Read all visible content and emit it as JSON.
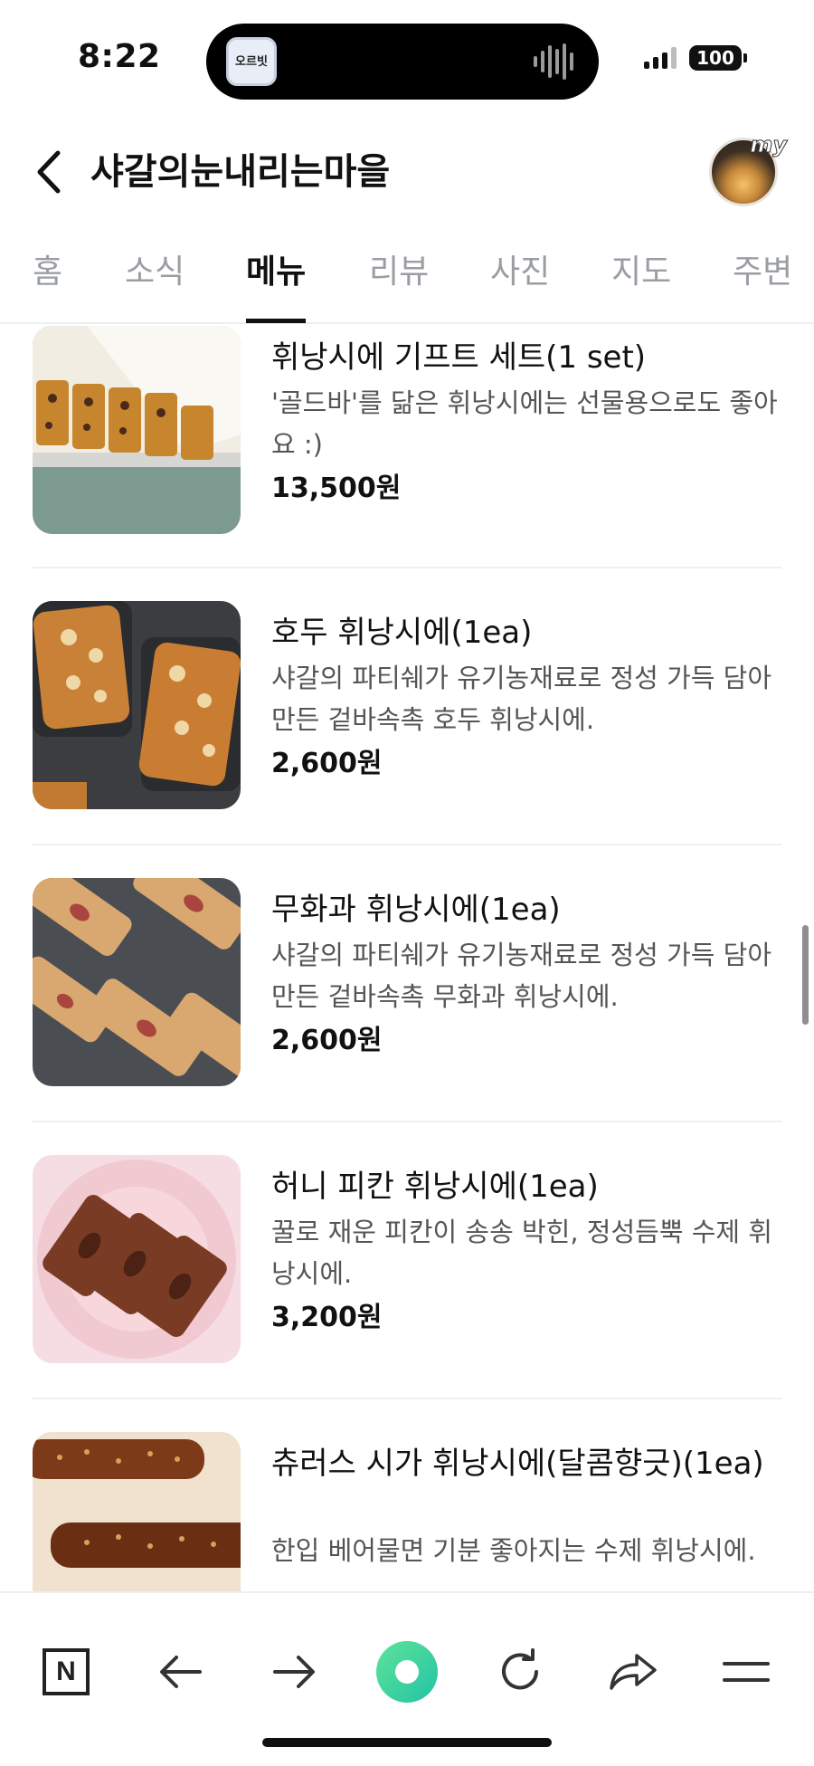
{
  "status_bar": {
    "time": "8:22",
    "island_app_label": "오르빗",
    "battery": "100",
    "icons": [
      "signal-icon",
      "battery-icon",
      "waveform-icon"
    ]
  },
  "header": {
    "title": "샤갈의눈내리는마을",
    "my_badge": "my",
    "icons": [
      "back-arrow-icon",
      "profile-avatar"
    ]
  },
  "tabs": [
    {
      "label": "홈",
      "active": false
    },
    {
      "label": "소식",
      "active": false
    },
    {
      "label": "메뉴",
      "active": true
    },
    {
      "label": "리뷰",
      "active": false
    },
    {
      "label": "사진",
      "active": false
    },
    {
      "label": "지도",
      "active": false
    },
    {
      "label": "주변",
      "active": false
    }
  ],
  "menu_items": [
    {
      "name": "휘낭시에 기프트 세트(1 set)",
      "description": "'골드바'를 닮은 휘낭시에는 선물용으로도 좋아요 :)",
      "price": "13,500원"
    },
    {
      "name": "호두 휘낭시에(1ea)",
      "description": "샤갈의 파티쉐가 유기농재료로 정성 가득 담아 만든 겉바속촉 호두 휘낭시에.",
      "price": "2,600원"
    },
    {
      "name": "무화과 휘낭시에(1ea)",
      "description": "샤갈의 파티쉐가 유기농재료로 정성 가득 담아 만든 겉바속촉 무화과 휘낭시에.",
      "price": "2,600원"
    },
    {
      "name": "허니 피칸 휘낭시에(1ea)",
      "description": "꿀로 재운 피칸이 송송 박힌, 정성듬뿍 수제 휘낭시에.",
      "price": "3,200원"
    },
    {
      "name": "츄러스 시가 휘낭시에(달콤향긋)(1ea)",
      "description": "한입 베어물면 기분 좋아지는 수제 휘낭시에.",
      "price": ""
    }
  ],
  "bottom_bar": {
    "n_label": "N",
    "buttons": [
      "naver-home-icon",
      "back-icon",
      "forward-icon",
      "green-dot-icon",
      "refresh-icon",
      "share-icon",
      "menu-icon"
    ]
  },
  "colors": {
    "accent_green": "#2fd49a",
    "text_primary": "#111111",
    "text_secondary": "#555555",
    "tab_inactive": "#9a9ea3"
  }
}
